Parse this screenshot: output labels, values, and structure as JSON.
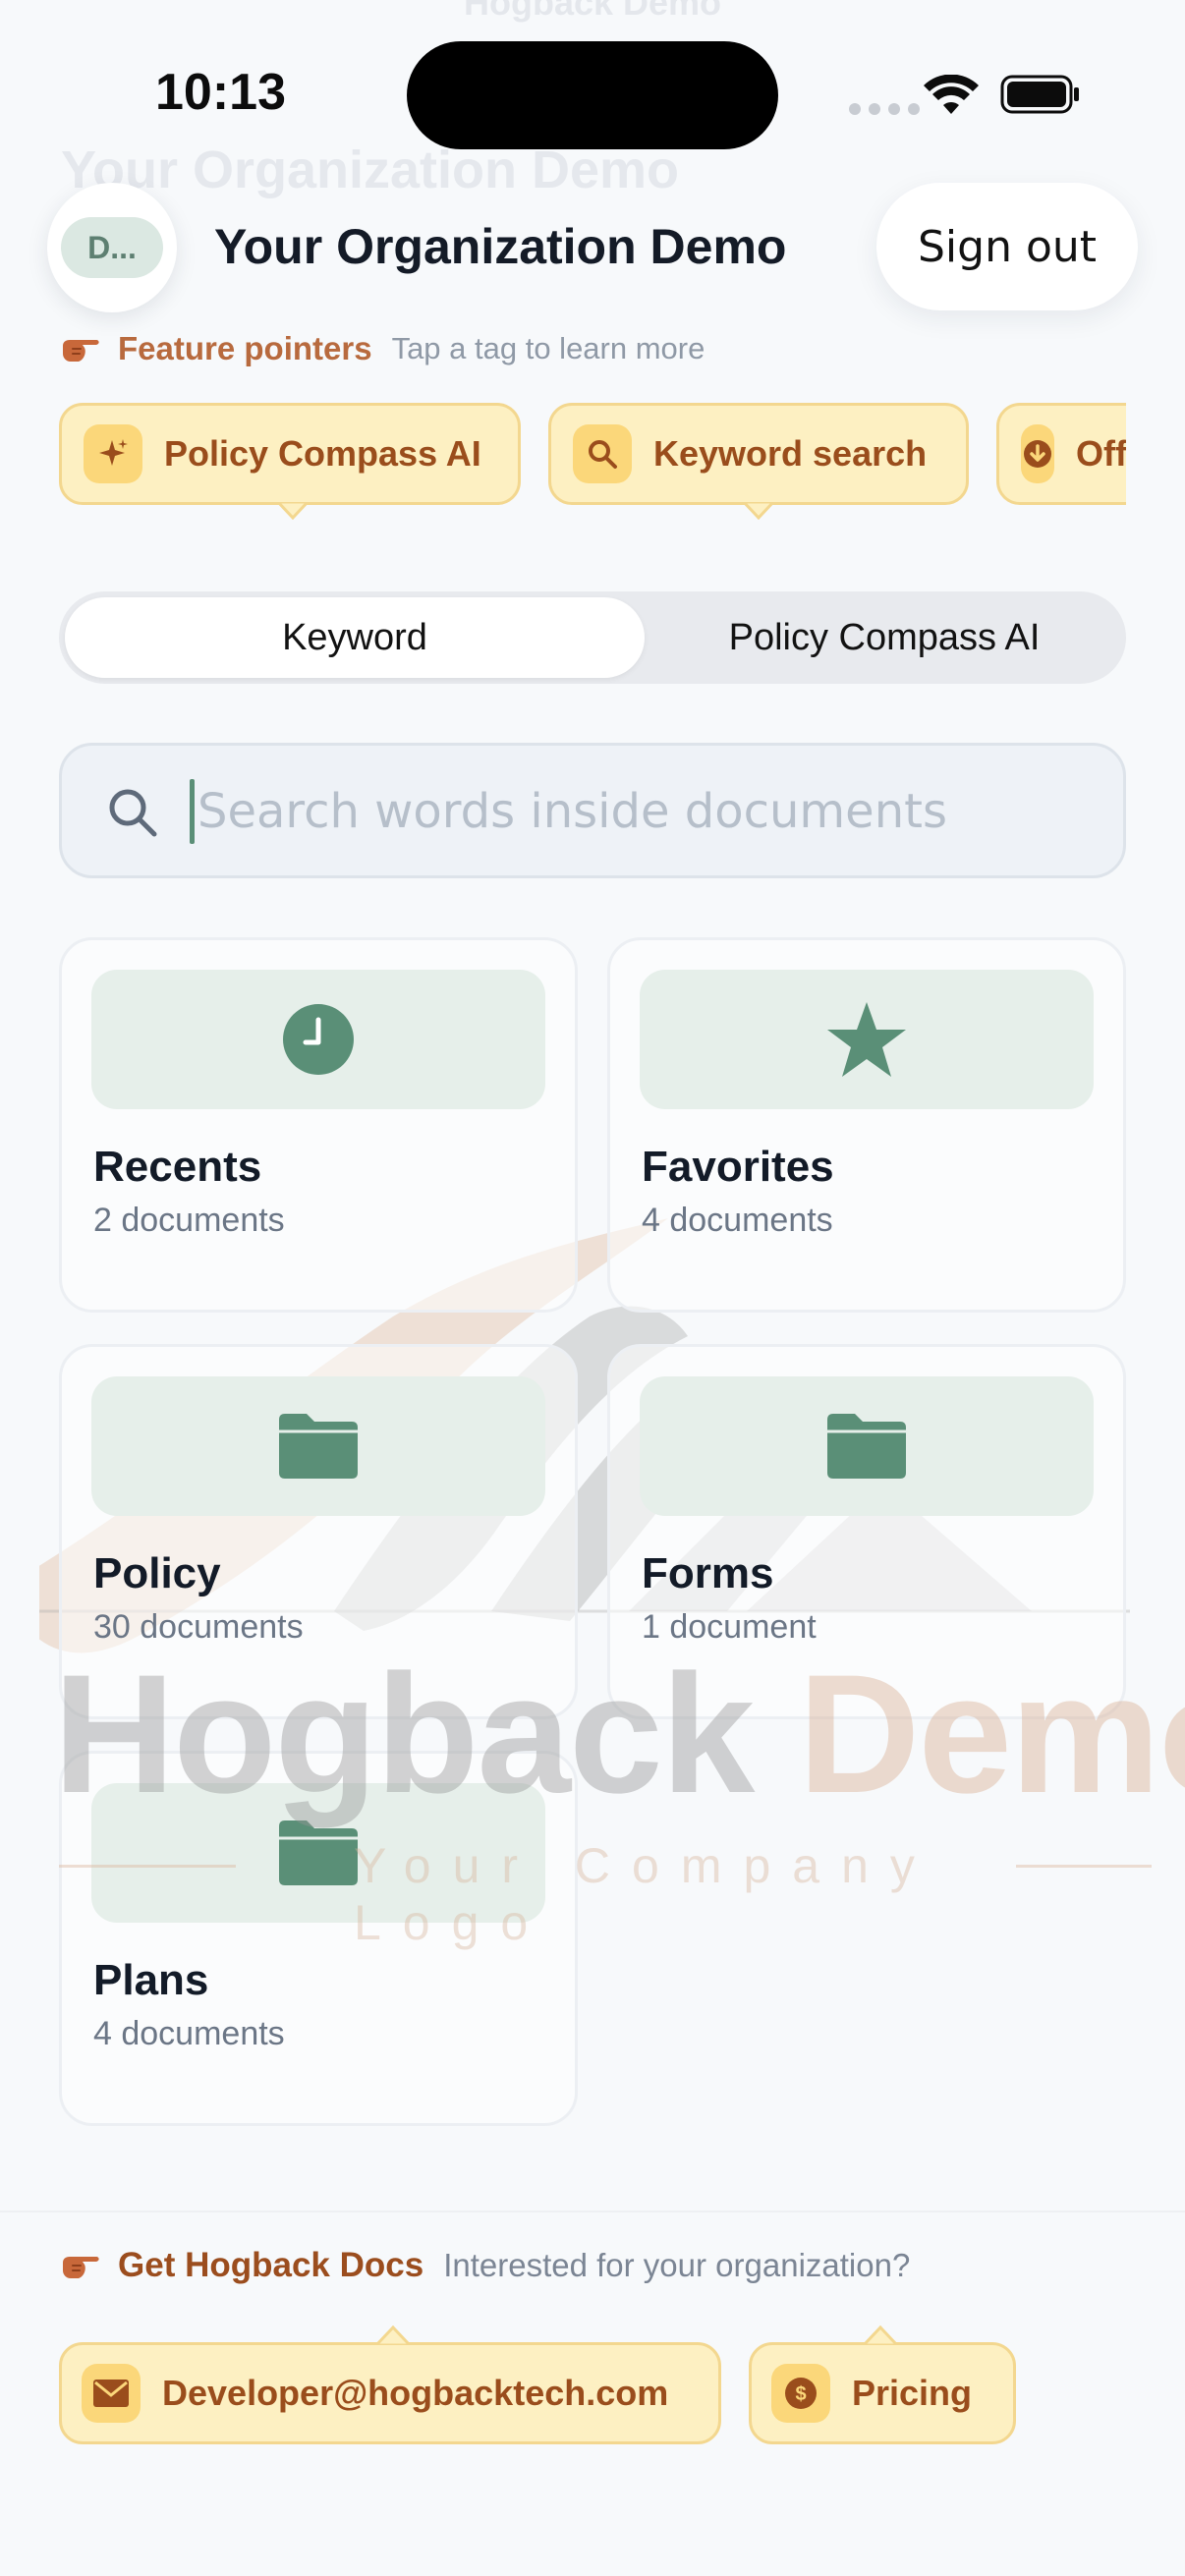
{
  "status_bar": {
    "time": "10:13"
  },
  "header": {
    "ghost_top": "Hogback Demo",
    "ghost_title": "Your Organization Demo",
    "avatar_initials": "D...",
    "title": "Your Organization Demo",
    "sign_out": "Sign out"
  },
  "feature_pointers": {
    "label": "Feature pointers",
    "hint": "Tap a tag to learn more",
    "chips": [
      {
        "label": "Policy Compass AI",
        "icon": "sparkles-icon"
      },
      {
        "label": "Keyword search",
        "icon": "search-icon"
      },
      {
        "label": "Offline downloads",
        "icon": "download-icon"
      }
    ]
  },
  "segmented": {
    "options": [
      "Keyword",
      "Policy Compass AI"
    ],
    "selected": "Keyword"
  },
  "search": {
    "placeholder": "Search words inside documents",
    "value": ""
  },
  "collections": [
    {
      "title": "Recents",
      "subtitle": "2 documents",
      "icon": "clock-icon"
    },
    {
      "title": "Favorites",
      "subtitle": "4 documents",
      "icon": "star-icon"
    },
    {
      "title": "Policy",
      "subtitle": "30 documents",
      "icon": "folder-icon"
    },
    {
      "title": "Forms",
      "subtitle": "1 document",
      "icon": "folder-icon"
    },
    {
      "title": "Plans",
      "subtitle": "4 documents",
      "icon": "folder-icon"
    }
  ],
  "watermark": {
    "word1": "Hogback",
    "word2": "Demo",
    "tagline": "Your Company Logo"
  },
  "get_docs": {
    "label": "Get Hogback Docs",
    "hint": "Interested for your organization?",
    "chips": [
      {
        "label": "Developer@hogbacktech.com",
        "icon": "mail-icon"
      },
      {
        "label": "Pricing",
        "icon": "dollar-icon"
      }
    ]
  },
  "colors": {
    "accent_green": "#5a8f77",
    "chip_bg": "#fdf0c2",
    "chip_border": "#f3d78f",
    "chip_text": "#9a4d1c",
    "background": "#f7f9fb"
  }
}
